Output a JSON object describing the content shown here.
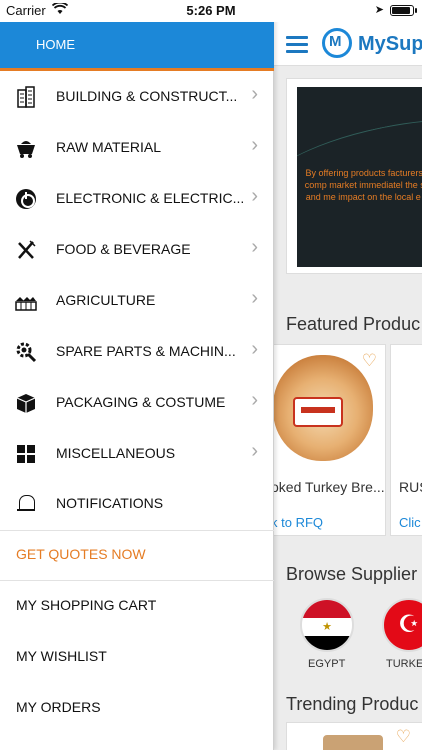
{
  "status_bar": {
    "carrier": "Carrier",
    "time": "5:26 PM",
    "battery_level": 0.9
  },
  "app": {
    "logo_text": "MySupp",
    "banner_text": "By offering products facturers and comp market immediatel the small and me impact on the local e thes",
    "featured_title": "Featured Produc",
    "products": [
      {
        "name": "oked Turkey Bre...",
        "link": "k to RFQ"
      },
      {
        "name": "RUS",
        "link": "Clic"
      }
    ],
    "browse_title": "Browse Supplier",
    "countries": [
      {
        "label": "EGYPT"
      },
      {
        "label": "TURKE"
      }
    ],
    "trending_title": "Trending Produc"
  },
  "drawer": {
    "header": "HOME",
    "categories": [
      {
        "label": "BUILDING & CONSTRUCT...",
        "icon": "building-icon"
      },
      {
        "label": "RAW MATERIAL",
        "icon": "mine-cart-icon"
      },
      {
        "label": "ELECTRONIC & ELECTRIC...",
        "icon": "power-icon"
      },
      {
        "label": "FOOD & BEVERAGE",
        "icon": "fork-knife-icon"
      },
      {
        "label": "AGRICULTURE",
        "icon": "farm-icon"
      },
      {
        "label": "SPARE PARTS & MACHIN...",
        "icon": "gear-wrench-icon"
      },
      {
        "label": "PACKAGING & COSTUME",
        "icon": "package-icon"
      },
      {
        "label": "MISCELLANEOUS",
        "icon": "grid-icon"
      }
    ],
    "notifications": "NOTIFICATIONS",
    "get_quotes": "GET QUOTES NOW",
    "shopping_cart": "MY SHOPPING CART",
    "wishlist": "MY WISHLIST",
    "orders": "MY ORDERS"
  },
  "colors": {
    "primary_blue": "#1c88d8",
    "accent_orange": "#e57c24"
  }
}
